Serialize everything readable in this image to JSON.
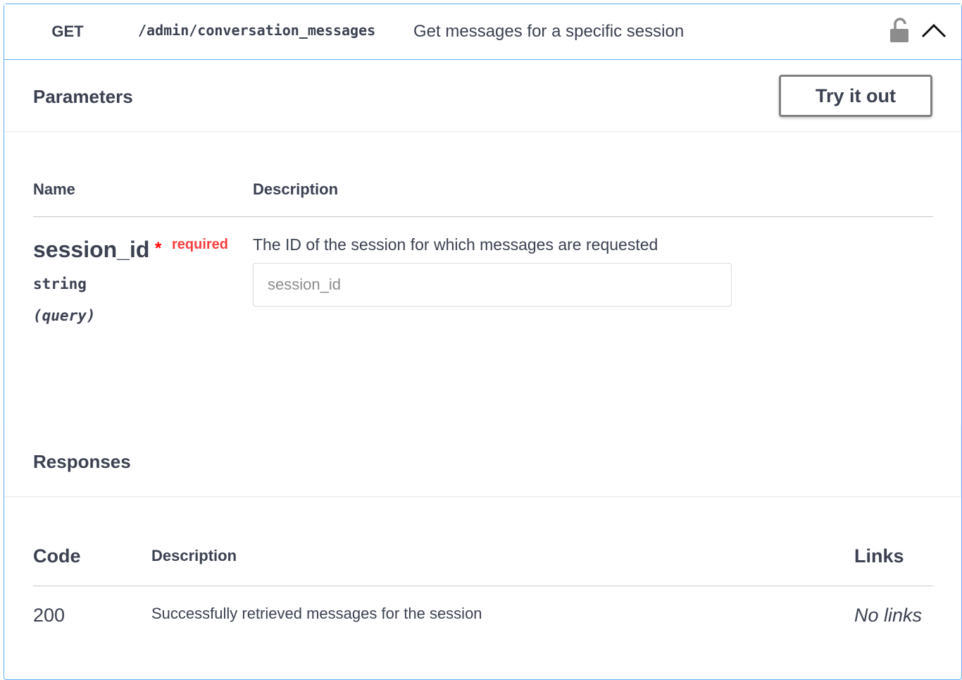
{
  "operation": {
    "method": "GET",
    "path": "/admin/conversation_messages",
    "summary": "Get messages for a specific session",
    "icons": {
      "lock": "lock-open-icon",
      "collapse": "chevron-up-icon"
    }
  },
  "parameters": {
    "title": "Parameters",
    "try_it_out_label": "Try it out",
    "columns": {
      "name": "Name",
      "description": "Description"
    },
    "items": [
      {
        "name": "session_id",
        "required_star": "*",
        "required_label": "required",
        "type": "string",
        "in": "(query)",
        "description": "The ID of the session for which messages are requested",
        "placeholder": "session_id",
        "value": ""
      }
    ]
  },
  "responses": {
    "title": "Responses",
    "columns": {
      "code": "Code",
      "description": "Description",
      "links": "Links"
    },
    "items": [
      {
        "code": "200",
        "description": "Successfully retrieved messages for the session",
        "links": "No links"
      }
    ]
  },
  "colors": {
    "accent_border": "#61affe",
    "text": "#3b4151",
    "required": "#f93e3e",
    "button_border": "#808080"
  }
}
